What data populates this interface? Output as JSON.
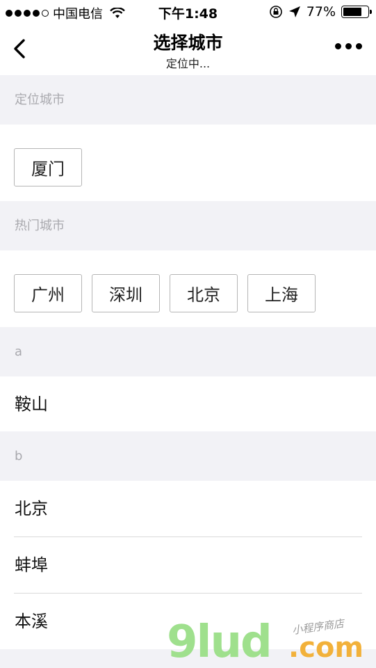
{
  "status_bar": {
    "carrier": "中国电信",
    "time": "下午1:48",
    "battery": "77%",
    "battery_level": 0.77
  },
  "nav": {
    "title": "选择城市",
    "subtitle": "定位中..."
  },
  "sections": {
    "located_header": "定位城市",
    "located_city": "厦门",
    "hot_header": "热门城市",
    "hot_cities": [
      "广州",
      "深圳",
      "北京",
      "上海"
    ],
    "group_a": {
      "letter": "a",
      "cities": [
        "鞍山"
      ]
    },
    "group_b": {
      "letter": "b",
      "cities": [
        "北京",
        "蚌埠",
        "本溪"
      ]
    }
  },
  "watermark": {
    "brand": "9lud",
    "suffix": ".com",
    "tagline": "小程序商店"
  },
  "icons": {
    "back": "chevron-left-icon",
    "more": "more-dots-icon",
    "wifi": "wifi-icon",
    "lock": "orientation-lock-icon",
    "location": "location-arrow-icon",
    "battery": "battery-icon"
  }
}
